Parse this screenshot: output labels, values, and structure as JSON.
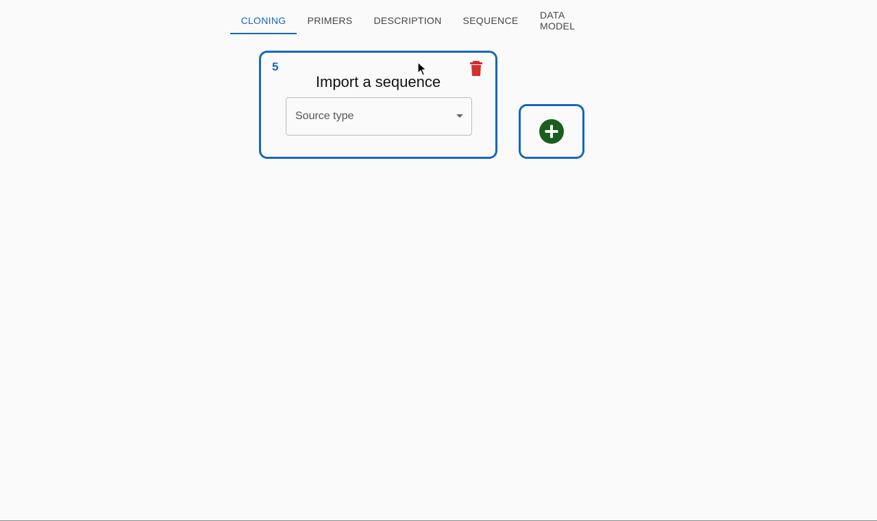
{
  "tabs": [
    {
      "label": "CLONING",
      "active": true
    },
    {
      "label": "PRIMERS",
      "active": false
    },
    {
      "label": "DESCRIPTION",
      "active": false
    },
    {
      "label": "SEQUENCE",
      "active": false
    },
    {
      "label": "DATA MODEL",
      "active": false
    }
  ],
  "source_card": {
    "id": "5",
    "title": "Import a sequence",
    "select": {
      "label": "Source type",
      "value": ""
    },
    "delete_icon": "trash-icon"
  },
  "add_card": {
    "icon": "add-circle-icon"
  },
  "colors": {
    "accent": "#1565c0",
    "delete": "#d32f2f",
    "add": "#1b5e20",
    "background": "#fafafa"
  }
}
